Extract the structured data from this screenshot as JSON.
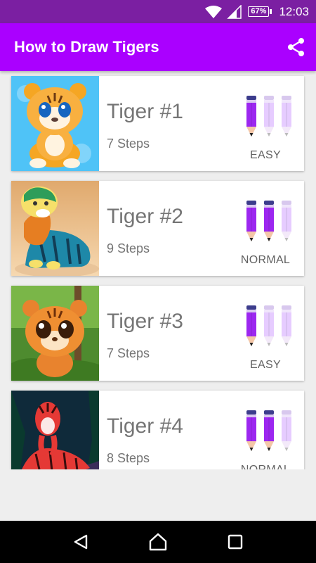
{
  "status": {
    "battery": "67%",
    "time": "12:03"
  },
  "app_bar": {
    "title": "How to Draw Tigers"
  },
  "colors": {
    "status_bar": "#7b1fa2",
    "app_bar": "#aa00ff",
    "pencil_active": "#9c27f0",
    "pencil_inactive": "#e6ccff"
  },
  "items": [
    {
      "title": "Tiger #1",
      "steps": "7 Steps",
      "difficulty": "EASY",
      "level": 1
    },
    {
      "title": "Tiger #2",
      "steps": "9 Steps",
      "difficulty": "NORMAL",
      "level": 2
    },
    {
      "title": "Tiger #3",
      "steps": "7 Steps",
      "difficulty": "EASY",
      "level": 1
    },
    {
      "title": "Tiger #4",
      "steps": "8 Steps",
      "difficulty": "NORMAL",
      "level": 2
    }
  ],
  "icons": {
    "share": "share-icon",
    "back": "back-triangle-icon",
    "home": "home-icon",
    "recents": "recents-square-icon"
  }
}
